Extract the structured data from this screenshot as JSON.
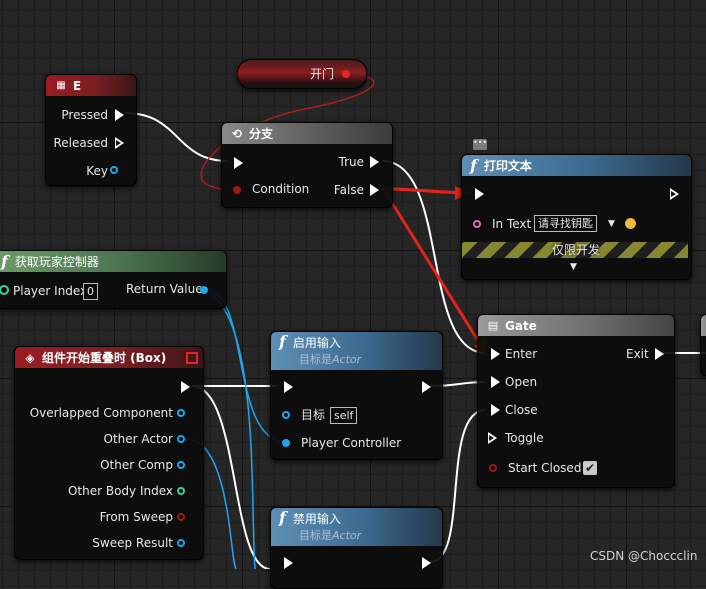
{
  "colors": {
    "exec_pin": "#ffffff",
    "object_pin": "#1ea7f0",
    "int_pin": "#36d3a3",
    "bool_pin": "#a2151b",
    "string_pin": "#e56bb9",
    "arrow": "#e6221b",
    "event_header": "#9a1d24",
    "function_header": "#3c6a8f",
    "pure_function_header": "#4b7450"
  },
  "reroute": {
    "label": "开门"
  },
  "key_event": {
    "title": "E",
    "icon": "keyboard-icon",
    "pins": {
      "pressed": "Pressed",
      "released": "Released",
      "key": "Key"
    }
  },
  "branch": {
    "title": "分支",
    "icon": "branch-icon",
    "pins": {
      "true_label": "True",
      "false_label": "False",
      "condition": "Condition"
    }
  },
  "print": {
    "title": "打印文本",
    "in_text_label": "In Text",
    "in_text_value": "请寻找钥匙",
    "dev_only": "仅限开发",
    "comment_icon": "comment-bubble-icon"
  },
  "get_pc": {
    "title": "获取玩家控制器",
    "player_index_label": "Player Index",
    "player_index_value": "0",
    "return_value": "Return Value"
  },
  "overlap": {
    "title": "组件开始重叠时 (Box)",
    "icon": "event-diamond-icon",
    "pins": [
      "Overlapped Component",
      "Other Actor",
      "Other Comp",
      "Other Body Index",
      "From Sweep",
      "Sweep Result"
    ]
  },
  "enable_input": {
    "title": "启用输入",
    "subtitle_prefix": "目标是",
    "subtitle_class": "Actor",
    "target_label": "目标",
    "target_value": "self",
    "pc_label": "Player Controller"
  },
  "disable_input": {
    "title": "禁用输入",
    "subtitle_prefix": "目标是",
    "subtitle_class": "Actor"
  },
  "gate": {
    "title": "Gate",
    "icon": "gate-icon",
    "pins": {
      "enter": "Enter",
      "open": "Open",
      "close": "Close",
      "toggle": "Toggle",
      "start_closed": "Start Closed",
      "exit": "Exit"
    },
    "start_closed_checked": true
  },
  "watermark": "CSDN @Choccclin"
}
